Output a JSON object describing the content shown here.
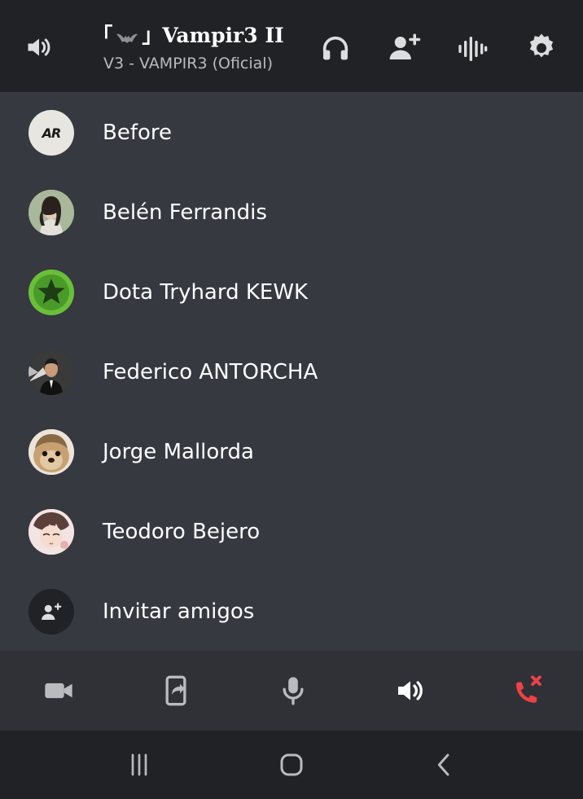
{
  "header": {
    "title_prefix": "「",
    "title_suffix": "」Vampir3 II",
    "subtitle": "V3 - VAMPIR3 (Oficial)",
    "icons": [
      "speaker-icon",
      "headphones-icon",
      "add-friend-icon",
      "soundboard-icon",
      "gear-icon"
    ]
  },
  "participants": [
    {
      "name": "Before",
      "avatar": "AR",
      "avatar_bg": "#e8e6e1"
    },
    {
      "name": "Belén Ferrandis",
      "avatar": "",
      "avatar_bg": "#c9b9a8"
    },
    {
      "name": "Dota Tryhard KEWK",
      "avatar": "",
      "avatar_bg": "#6abf3a"
    },
    {
      "name": "Federico ANTORCHA",
      "avatar": "",
      "avatar_bg": "#2b2b2b"
    },
    {
      "name": "Jorge Mallorda",
      "avatar": "",
      "avatar_bg": "#d8c9b4"
    },
    {
      "name": "Teodoro Bejero",
      "avatar": "",
      "avatar_bg": "#e9d6d2"
    }
  ],
  "invite": {
    "label": "Invitar amigos"
  },
  "controls": {
    "icons": [
      "video-icon",
      "screen-share-icon",
      "microphone-icon",
      "speaker-icon",
      "hang-up-icon"
    ],
    "hangup_color": "#ed4245"
  },
  "navbar": {
    "icons": [
      "recents-icon",
      "home-icon",
      "back-icon"
    ]
  },
  "colors": {
    "header_bg": "#202225",
    "list_bg": "#36393f",
    "controls_bg": "#2f3136"
  }
}
